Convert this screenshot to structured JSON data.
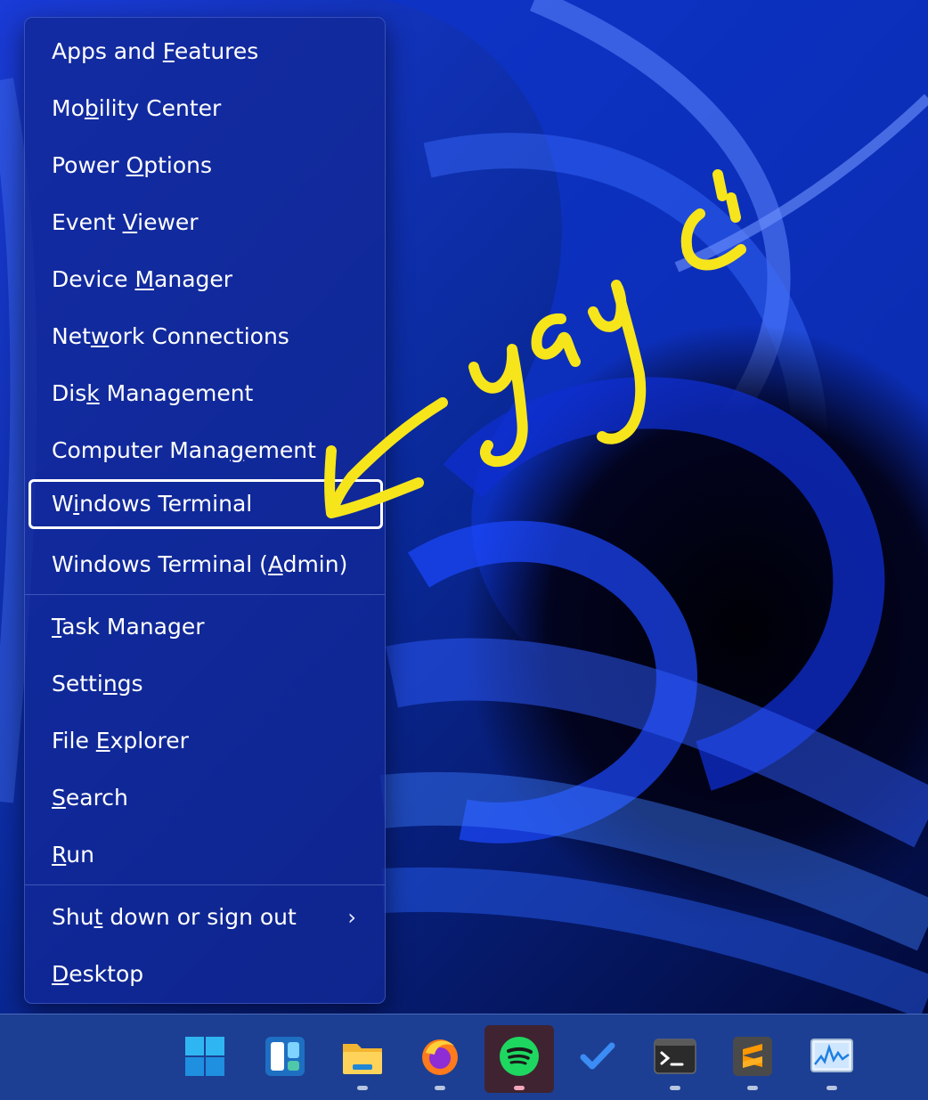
{
  "menu": {
    "items": [
      {
        "pre": "Apps and ",
        "key": "F",
        "post": "eatures"
      },
      {
        "pre": "Mo",
        "key": "b",
        "post": "ility Center"
      },
      {
        "pre": "Power ",
        "key": "O",
        "post": "ptions"
      },
      {
        "pre": "Event ",
        "key": "V",
        "post": "iewer"
      },
      {
        "pre": "Device ",
        "key": "M",
        "post": "anager"
      },
      {
        "pre": "Net",
        "key": "w",
        "post": "ork Connections"
      },
      {
        "pre": "Dis",
        "key": "k",
        "post": " Management"
      },
      {
        "pre": "Computer Mana",
        "key": "g",
        "post": "ement"
      },
      {
        "pre": "W",
        "key": "i",
        "post": "ndows Terminal"
      },
      {
        "pre": "Windows Terminal (",
        "key": "A",
        "post": "dmin)"
      },
      {
        "pre": "",
        "key": "T",
        "post": "ask Manager"
      },
      {
        "pre": "Setti",
        "key": "n",
        "post": "gs"
      },
      {
        "pre": "File ",
        "key": "E",
        "post": "xplorer"
      },
      {
        "pre": "",
        "key": "S",
        "post": "earch"
      },
      {
        "pre": "",
        "key": "R",
        "post": "un"
      },
      {
        "pre": "Shu",
        "key": "t",
        "post": " down or sign out"
      },
      {
        "pre": "",
        "key": "D",
        "post": "esktop"
      }
    ],
    "focused_item": "Windows Terminal",
    "submenu_chevron": "›"
  },
  "annotation": {
    "handwritten_text": "yay :\")",
    "color": "#f7e51b",
    "arrow_points_to": "Windows Terminal"
  },
  "taskbar": {
    "background": "#1c3f93",
    "apps": [
      {
        "name": "Start",
        "icon": "windows-start-icon",
        "running": false,
        "active": false
      },
      {
        "name": "Widgets",
        "icon": "widgets-icon",
        "running": false,
        "active": false
      },
      {
        "name": "File Explorer",
        "icon": "file-explorer-icon",
        "running": true,
        "active": false
      },
      {
        "name": "Firefox",
        "icon": "firefox-icon",
        "running": true,
        "active": false
      },
      {
        "name": "Spotify",
        "icon": "spotify-icon",
        "running": true,
        "active": true
      },
      {
        "name": "Microsoft To Do",
        "icon": "todo-checkmark-icon",
        "running": false,
        "active": false
      },
      {
        "name": "Windows Terminal",
        "icon": "terminal-icon",
        "running": true,
        "active": false
      },
      {
        "name": "Sublime Text",
        "icon": "sublime-text-icon",
        "running": true,
        "active": false
      },
      {
        "name": "Resource Monitor",
        "icon": "resource-monitor-icon",
        "running": true,
        "active": false
      }
    ]
  }
}
